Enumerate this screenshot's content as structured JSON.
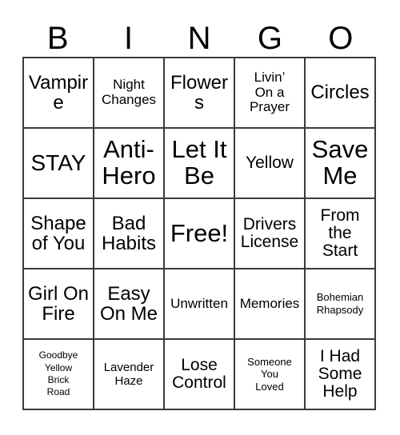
{
  "card": {
    "title": "BINGO",
    "header_letters": [
      "B",
      "I",
      "N",
      "G",
      "O"
    ],
    "colors": {
      "background": "#ffffff",
      "text": "#000000",
      "grid_line": "#3a3a3a"
    },
    "grid": {
      "columns": 5,
      "rows": 5,
      "free_space": {
        "row": 3,
        "column": 3,
        "label": "Free!"
      }
    },
    "cells": [
      [
        {
          "label": "Vampire",
          "size": "lg"
        },
        {
          "label": "Night\nChanges",
          "size": "sm"
        },
        {
          "label": "Flowers",
          "size": "lg"
        },
        {
          "label": "Livin’\nOn a\nPrayer",
          "size": "sm"
        },
        {
          "label": "Circles",
          "size": "lg"
        }
      ],
      [
        {
          "label": "STAY",
          "size": "xl"
        },
        {
          "label": "Anti-\nHero",
          "size": "xxl"
        },
        {
          "label": "Let It\nBe",
          "size": "xxl"
        },
        {
          "label": "Yellow",
          "size": "md"
        },
        {
          "label": "Save\nMe",
          "size": "xxl"
        }
      ],
      [
        {
          "label": "Shape\nof You",
          "size": "lg"
        },
        {
          "label": "Bad\nHabits",
          "size": "lg"
        },
        {
          "label": "Free!",
          "size": "xxl"
        },
        {
          "label": "Drivers\nLicense",
          "size": "md"
        },
        {
          "label": "From\nthe\nStart",
          "size": "md"
        }
      ],
      [
        {
          "label": "Girl On\nFire",
          "size": "lg"
        },
        {
          "label": "Easy\nOn Me",
          "size": "lg"
        },
        {
          "label": "Unwritten",
          "size": "sm"
        },
        {
          "label": "Memories",
          "size": "sm"
        },
        {
          "label": "Bohemian\nRhapsody",
          "size": "xxs"
        }
      ],
      [
        {
          "label": "Goodbye\nYellow\nBrick\nRoad",
          "size": "tiny"
        },
        {
          "label": "Lavender\nHaze",
          "size": "xs"
        },
        {
          "label": "Lose\nControl",
          "size": "md"
        },
        {
          "label": "Someone\nYou\nLoved",
          "size": "xxs"
        },
        {
          "label": "I Had\nSome\nHelp",
          "size": "md"
        }
      ]
    ]
  }
}
